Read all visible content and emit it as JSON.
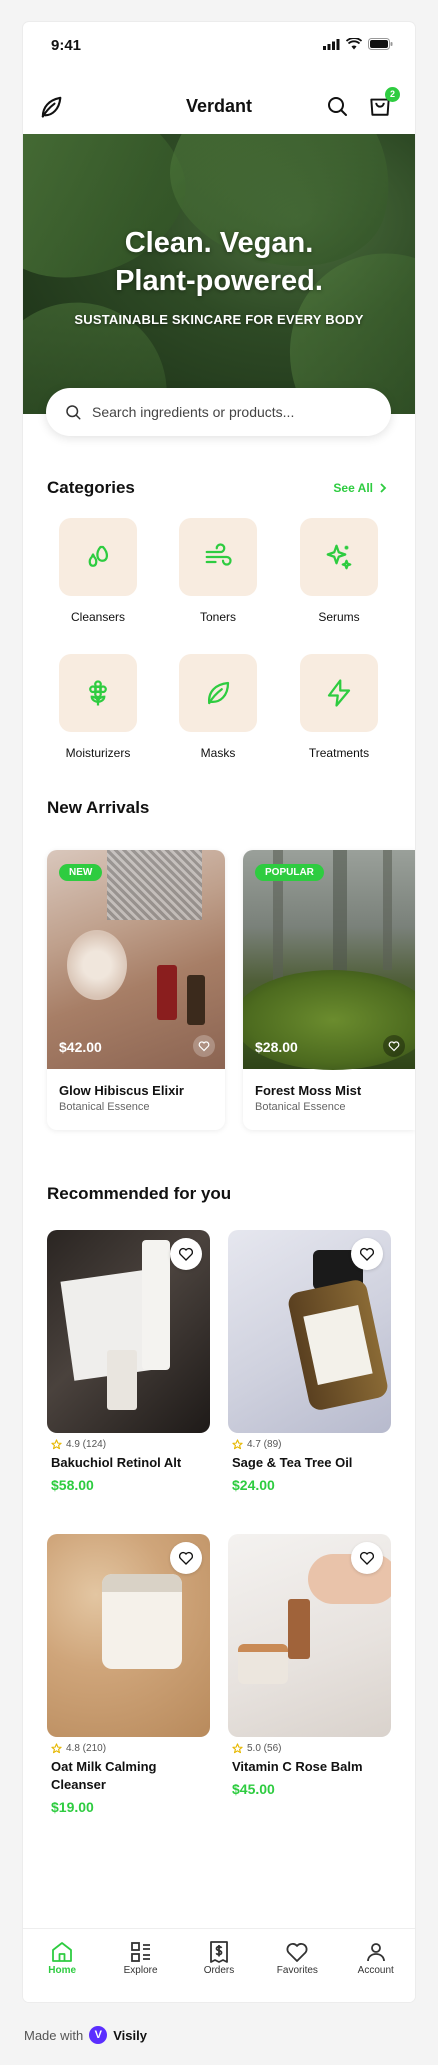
{
  "status": {
    "time": "9:41"
  },
  "header": {
    "title": "Verdant",
    "cart_count": "2"
  },
  "hero": {
    "line1": "Clean. Vegan.",
    "line2": "Plant-powered.",
    "subtitle": "SUSTAINABLE SKINCARE FOR EVERY BODY"
  },
  "search": {
    "placeholder": "Search ingredients or products..."
  },
  "categories": {
    "title": "Categories",
    "see_all": "See All",
    "items": [
      {
        "label": "Cleansers",
        "icon": "droplets-icon"
      },
      {
        "label": "Toners",
        "icon": "wind-icon"
      },
      {
        "label": "Serums",
        "icon": "sparkles-icon"
      },
      {
        "label": "Moisturizers",
        "icon": "flower-icon"
      },
      {
        "label": "Masks",
        "icon": "leaf-icon"
      },
      {
        "label": "Treatments",
        "icon": "zap-icon"
      }
    ]
  },
  "new_arrivals": {
    "title": "New Arrivals",
    "items": [
      {
        "tag": "NEW",
        "price": "$42.00",
        "name": "Glow Hibiscus Elixir",
        "brand": "Botanical Essence"
      },
      {
        "tag": "POPULAR",
        "price": "$28.00",
        "name": "Forest Moss Mist",
        "brand": "Botanical Essence"
      }
    ]
  },
  "recommended": {
    "title": "Recommended for you",
    "items": [
      {
        "rating": "4.9 (124)",
        "name": "Bakuchiol Retinol Alt",
        "price": "$58.00"
      },
      {
        "rating": "4.7 (89)",
        "name": "Sage & Tea Tree Oil",
        "price": "$24.00"
      },
      {
        "rating": "4.8 (210)",
        "name": "Oat Milk Calming Cleanser",
        "price": "$19.00"
      },
      {
        "rating": "5.0 (56)",
        "name": "Vitamin C Rose Balm",
        "price": "$45.00"
      }
    ]
  },
  "tabs": [
    {
      "label": "Home",
      "icon": "home-icon",
      "active": true
    },
    {
      "label": "Explore",
      "icon": "explore-icon"
    },
    {
      "label": "Orders",
      "icon": "receipt-icon"
    },
    {
      "label": "Favorites",
      "icon": "heart-icon"
    },
    {
      "label": "Account",
      "icon": "user-icon"
    }
  ],
  "footer": {
    "made_with": "Made with",
    "brand": "Visily"
  },
  "colors": {
    "accent": "#2ecc40",
    "tile": "#f8ece0"
  }
}
